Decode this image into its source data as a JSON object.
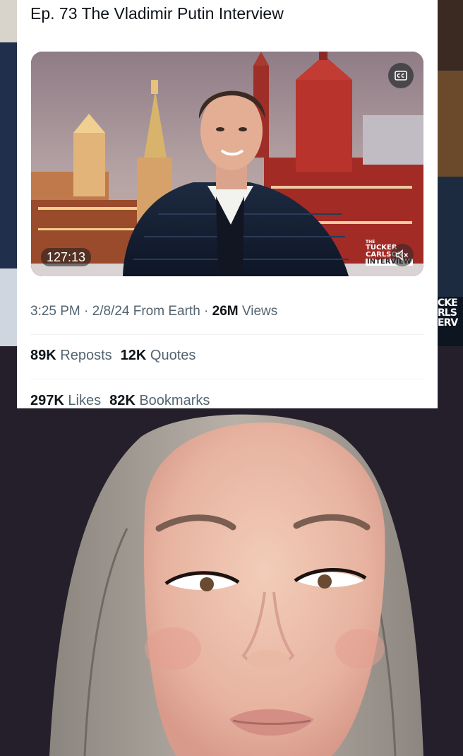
{
  "tweet": {
    "title": "Ep. 73  The Vladimir Putin Interview",
    "video": {
      "duration": "127:13",
      "logo_lines": [
        "THE",
        "TUCKER",
        "CARLSON",
        "INTERVIEW"
      ]
    },
    "meta": {
      "time": "3:25 PM · 2/8/24 From Earth · ",
      "views_count": "26M",
      "views_label": " Views"
    },
    "stats": {
      "reposts_count": "89K",
      "reposts_label": "Reposts",
      "quotes_count": "12K",
      "quotes_label": "Quotes",
      "likes_count": "297K",
      "likes_label": "Likes",
      "bookmarks_count": "82K",
      "bookmarks_label": "Bookmarks"
    }
  },
  "background": {
    "right_edge_text": [
      "CKE",
      "RLS",
      "ERV"
    ]
  },
  "colors": {
    "text_primary": "#0f1419",
    "text_secondary": "#536471",
    "page_dark": "#241f2a"
  },
  "icons": [
    "captions-icon",
    "mute-icon"
  ]
}
